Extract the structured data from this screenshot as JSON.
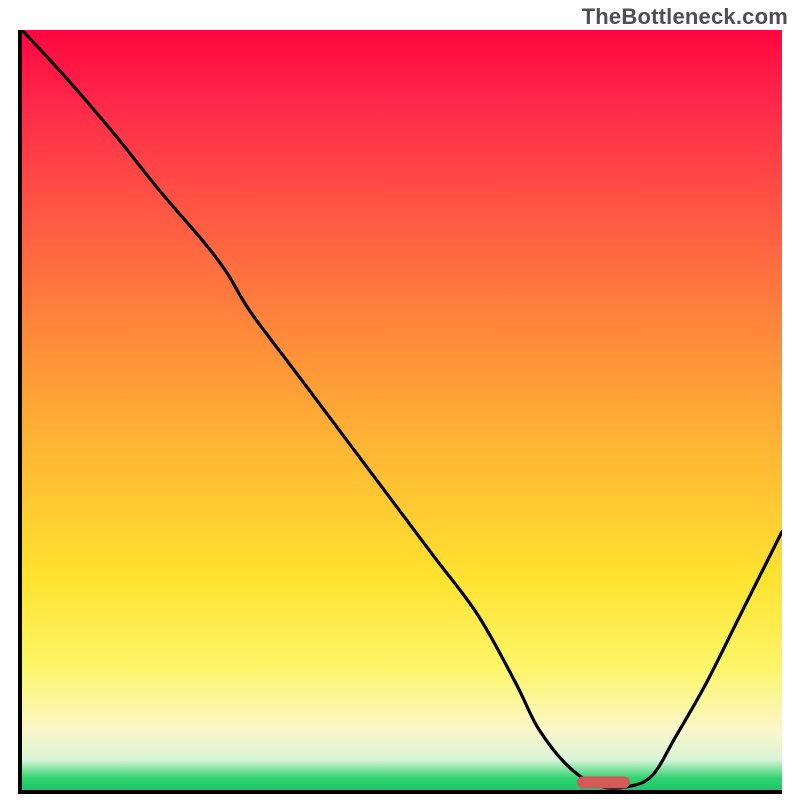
{
  "chart_data": {
    "type": "line",
    "watermark": "TheBottleneck.com",
    "gradient_colors": {
      "top": "#ff0640",
      "mid_upper": "#ff8a3a",
      "mid_lower": "#ffe22f",
      "pale": "#fbf7c8",
      "green": "#19c868"
    },
    "x_range_normalized": [
      0,
      1
    ],
    "y_range_normalized": [
      0,
      1
    ],
    "series": [
      {
        "name": "curve",
        "x": [
          0.0,
          0.06,
          0.12,
          0.18,
          0.24,
          0.27,
          0.3,
          0.36,
          0.42,
          0.48,
          0.54,
          0.6,
          0.65,
          0.68,
          0.72,
          0.76,
          0.8,
          0.83,
          0.86,
          0.9,
          0.94,
          0.98,
          1.0
        ],
        "y": [
          1.0,
          0.935,
          0.865,
          0.79,
          0.72,
          0.68,
          0.63,
          0.55,
          0.47,
          0.39,
          0.31,
          0.23,
          0.14,
          0.08,
          0.03,
          0.005,
          0.005,
          0.02,
          0.07,
          0.14,
          0.22,
          0.3,
          0.34
        ]
      }
    ],
    "marker": {
      "x_start_norm": 0.73,
      "x_end_norm": 0.8,
      "y_norm": 0.006,
      "color": "#d45a5a"
    },
    "xlabel": "",
    "ylabel": "",
    "title": "",
    "xlim": [
      0,
      1
    ],
    "ylim": [
      0,
      1
    ]
  }
}
